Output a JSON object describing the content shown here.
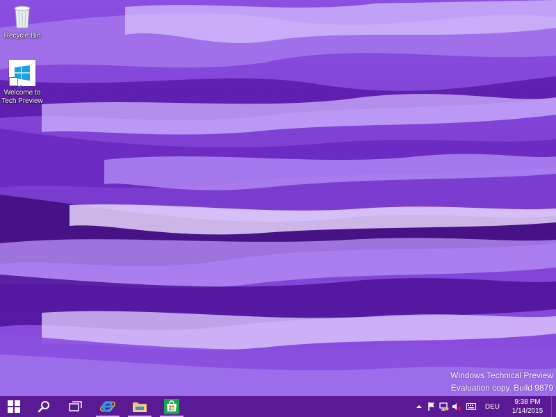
{
  "desktop": {
    "icons": [
      {
        "label": "Recycle Bin",
        "icon": "recycle-bin-icon"
      },
      {
        "label": "Welcome to Tech Preview",
        "icon": "windows-logo-icon"
      }
    ],
    "watermark": {
      "line1": "Windows Technical Preview",
      "line2": "Evaluation copy. Build 9879"
    }
  },
  "taskbar": {
    "color": "#5a1a94",
    "buttons": [
      {
        "name": "start",
        "icon": "windows-logo-icon"
      },
      {
        "name": "search",
        "icon": "search-icon"
      },
      {
        "name": "task-view",
        "icon": "task-view-icon"
      },
      {
        "name": "internet-explorer",
        "icon": "internet-explorer-icon"
      },
      {
        "name": "file-explorer",
        "icon": "folder-icon"
      },
      {
        "name": "store",
        "icon": "store-icon"
      }
    ],
    "tray": {
      "language": "DEU",
      "time": "9:38 PM",
      "date": "1/14/2015"
    }
  },
  "colors": {
    "wallpaper_base": "#7b3fd4",
    "wallpaper_light": "#c9a6ff",
    "wallpaper_dark": "#3d0a78"
  }
}
